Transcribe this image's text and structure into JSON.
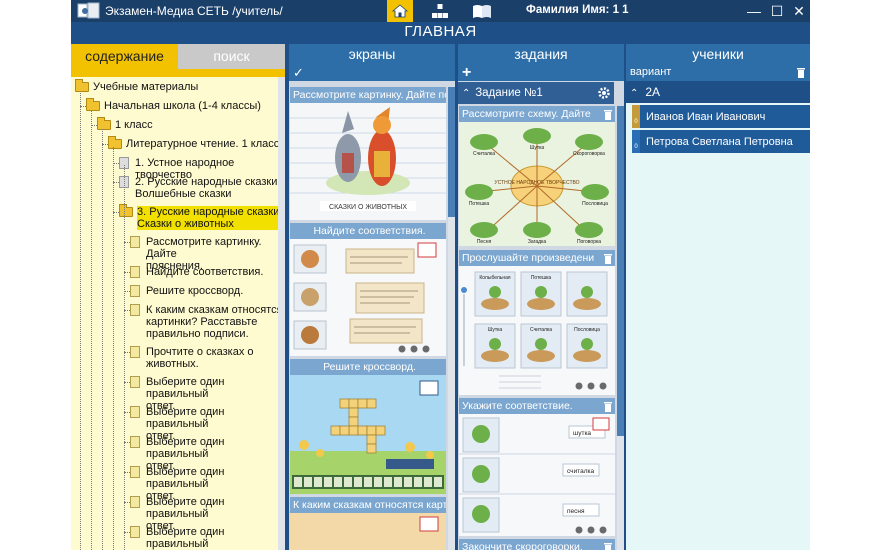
{
  "window": {
    "title": "Экзамен-Медиа СЕТЬ /учитель/",
    "user_name": "Фамилия Имя:  1 1",
    "nav_tabs": [
      "home-icon",
      "hierarchy-icon",
      "book-icon"
    ],
    "window_buttons": {
      "minimize": "—",
      "maximize": "☐",
      "close": "✕"
    }
  },
  "header": {
    "title": "ГЛАВНАЯ"
  },
  "left_panel": {
    "tabs": [
      {
        "label": "содержание",
        "active": true
      },
      {
        "label": "поиск",
        "active": false
      }
    ],
    "tree": [
      {
        "label": "Учебные материалы",
        "icon": "folder",
        "depth": 0
      },
      {
        "label": "Начальная школа (1-4 классы)",
        "icon": "folder",
        "depth": 1
      },
      {
        "label": "1 класс",
        "icon": "folder",
        "depth": 2
      },
      {
        "label": "Литературное чтение. 1 класс",
        "icon": "folder",
        "depth": 3
      },
      {
        "label": "1. Устное народное творчество",
        "icon": "doc-grey",
        "depth": 4
      },
      {
        "label": "2. Русские народные сказки.\nВолшебные сказки",
        "icon": "doc-grey",
        "depth": 4
      },
      {
        "label": "3. Русские народные сказки.\nСказки о животных",
        "icon": "folder",
        "depth": 4,
        "selected": true
      },
      {
        "label": "Рассмотрите картинку. Дайте\nпояснения.",
        "icon": "doc",
        "depth": 5
      },
      {
        "label": "Найдите соответствия.",
        "icon": "doc",
        "depth": 5
      },
      {
        "label": "Решите кроссворд.",
        "icon": "doc",
        "depth": 5
      },
      {
        "label": "К каким сказкам относятся\nкартинки? Расставьте\nправильно подписи.",
        "icon": "doc",
        "depth": 5
      },
      {
        "label": "Прочтите о сказках о\nживотных.",
        "icon": "doc",
        "depth": 5
      },
      {
        "label": "Выберите один правильный\nответ.",
        "icon": "doc",
        "depth": 5
      },
      {
        "label": "Выберите один правильный\nответ.",
        "icon": "doc",
        "depth": 5
      },
      {
        "label": "Выберите один правильный\nответ.",
        "icon": "doc",
        "depth": 5
      },
      {
        "label": "Выберите один правильный\nответ.",
        "icon": "doc",
        "depth": 5
      },
      {
        "label": "Выберите один правильный\nответ.",
        "icon": "doc",
        "depth": 5
      },
      {
        "label": "Выберите один правильный\nответ.",
        "icon": "doc",
        "depth": 5
      }
    ]
  },
  "screens_panel": {
    "title": "экраны",
    "check": "✓",
    "cards": [
      {
        "title": "Рассмотрите картинку. Дайте по",
        "caption": "СКАЗКИ О ЖИВОТНЫХ"
      },
      {
        "title": "Найдите соответствия."
      },
      {
        "title": "Решите кроссворд."
      },
      {
        "title": "К каким сказкам относятся карти"
      }
    ]
  },
  "tasks_panel": {
    "title": "задания",
    "plus": "+",
    "task_header": "Задание №1",
    "cards": [
      {
        "title": "Рассмотрите схему. Дайте",
        "center_label": "УСТНОЕ НАРОДНОЕ ТВОРЧЕСТВО",
        "labels": [
          "Считалка",
          "Шутка",
          "Скороговорка",
          "Потешка",
          "Пословица",
          "Песня",
          "Загадка",
          "Поговорка"
        ]
      },
      {
        "title": "Прослушайте произведени",
        "labels": [
          "Колыбельная",
          "Потешка",
          "Шутка",
          "Считалка",
          "Пословица"
        ]
      },
      {
        "title": "Укажите соответствие.",
        "labels": [
          "шутка",
          "считалка",
          "песня"
        ]
      },
      {
        "title": "Закончите скороговорки."
      }
    ]
  },
  "students_panel": {
    "title": "ученики",
    "subtitle": "вариант",
    "group": "2А",
    "students": [
      {
        "name": "Иванов Иван Иванович",
        "variant": "0",
        "badge_color": "#c49a3a"
      },
      {
        "name": "Петрова Светлана Петровна",
        "variant": "0",
        "badge_color": "#2a6fb5"
      }
    ]
  },
  "colors": {
    "app_bg": "#1e4f86",
    "title_bar": "#1a3f69",
    "accent_yellow": "#f2c200",
    "tree_bg": "#fffbd0",
    "card_title": "#7ba6cf"
  }
}
